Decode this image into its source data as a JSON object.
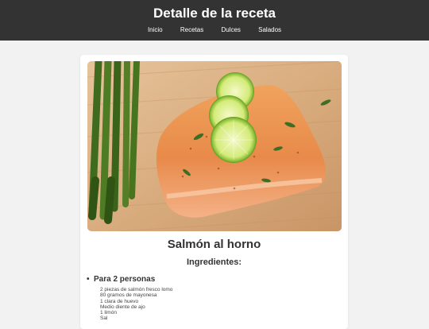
{
  "header": {
    "title": "Detalle de la receta",
    "nav": [
      "Inicio",
      "Recetas",
      "Dulces",
      "Salados"
    ]
  },
  "recipe": {
    "image_alt": "Salmón al horno con limón y espárragos",
    "title": "Salmón al horno",
    "ingredients_heading": "Ingredientes:",
    "serving_heading": "Para 2 personas",
    "ingredients": [
      "2 piezas de salmón fresco lomo",
      "80 gramos de mayonesa",
      "1 clara de huevo",
      "Medio diente de ajo",
      "1 limón",
      "Sal"
    ]
  },
  "colors": {
    "header_bg": "#333333",
    "page_bg": "#f2f2f2",
    "card_bg": "#ffffff"
  }
}
